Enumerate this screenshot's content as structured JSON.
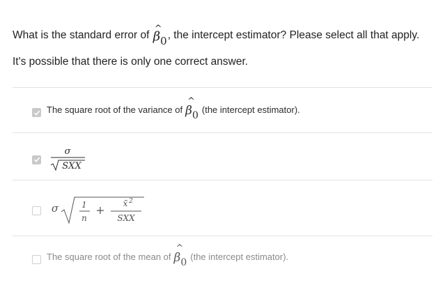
{
  "question": {
    "text_before": "What is the standard error of",
    "symbol": "β",
    "hat": "^",
    "subscript": "0",
    "text_after": ", the intercept estimator? Please select all that apply. It's possible that there is only one correct answer."
  },
  "options": [
    {
      "checked": true,
      "text_before": "The square root of the variance of",
      "symbol": "β",
      "hat": "^",
      "subscript": "0",
      "text_after": "(the intercept estimator)."
    },
    {
      "checked": true,
      "formula": {
        "numerator": "σ",
        "sqrt_content": "SXX"
      }
    },
    {
      "checked": false,
      "formula": {
        "coefficient": "σ",
        "term1_num": "1",
        "term1_den": "n",
        "plus": "+",
        "term2_num": "x̄",
        "term2_exp": "2",
        "term2_den": "SXX"
      }
    },
    {
      "checked": false,
      "text_before": "The square root of the mean of",
      "symbol": "β",
      "hat": "^",
      "subscript": "0",
      "text_after": "(the intercept estimator)."
    }
  ],
  "colors": {
    "checkbox_checked": "#c9c9c9",
    "checkbox_unchecked_border": "#cfcfcf",
    "divider": "#e2e2e2",
    "text_selected": "#2b2b2b",
    "text_unselected": "#8a8a8a"
  }
}
